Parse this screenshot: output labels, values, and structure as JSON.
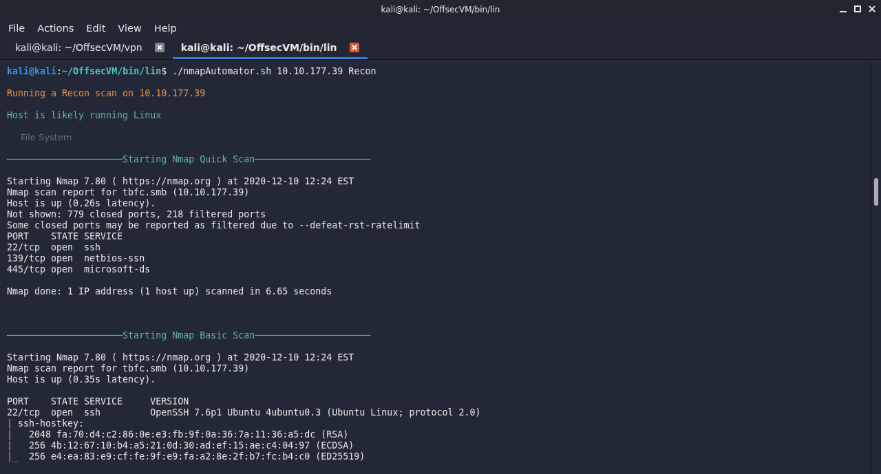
{
  "window": {
    "title": "kali@kali: ~/OffsecVM/bin/lin"
  },
  "menu": [
    "File",
    "Actions",
    "Edit",
    "View",
    "Help"
  ],
  "tabs": [
    {
      "label": "kali@kali: ~/OffsecVM/vpn",
      "selected": false
    },
    {
      "label": "kali@kali: ~/OffsecVM/bin/lin",
      "selected": true
    }
  ],
  "desktop": {
    "icon_label": "File System"
  },
  "terminal": {
    "lines": [
      {
        "kind": "text",
        "segments": [
          {
            "kind": "user",
            "text": "kali@kali"
          },
          {
            "kind": "plain",
            "text": ":"
          },
          {
            "kind": "path",
            "text": "~/OffsecVM/bin/lin"
          },
          {
            "kind": "plain",
            "text": "$ ./nmapAutomator.sh 10.10.177.39 Recon"
          }
        ]
      },
      {
        "kind": "blank"
      },
      {
        "kind": "text",
        "segments": [
          {
            "kind": "warn",
            "text": "Running a Recon scan on 10.10.177.39"
          }
        ]
      },
      {
        "kind": "blank"
      },
      {
        "kind": "text",
        "segments": [
          {
            "kind": "info",
            "text": "Host is likely running Linux"
          }
        ]
      },
      {
        "kind": "blank"
      },
      {
        "kind": "blank"
      },
      {
        "kind": "blank"
      },
      {
        "kind": "text",
        "segments": [
          {
            "kind": "info",
            "text": "─────────────────────Starting Nmap Quick Scan─────────────────────"
          }
        ]
      },
      {
        "kind": "blank"
      },
      {
        "kind": "text",
        "segments": [
          {
            "kind": "plain",
            "text": "Starting Nmap 7.80 ( https://nmap.org ) at 2020-12-10 12:24 EST"
          }
        ]
      },
      {
        "kind": "text",
        "segments": [
          {
            "kind": "plain",
            "text": "Nmap scan report for tbfc.smb (10.10.177.39)"
          }
        ]
      },
      {
        "kind": "text",
        "segments": [
          {
            "kind": "plain",
            "text": "Host is up (0.26s latency)."
          }
        ]
      },
      {
        "kind": "text",
        "segments": [
          {
            "kind": "plain",
            "text": "Not shown: 779 closed ports, 218 filtered ports"
          }
        ]
      },
      {
        "kind": "text",
        "segments": [
          {
            "kind": "plain",
            "text": "Some closed ports may be reported as filtered due to --defeat-rst-ratelimit"
          }
        ]
      },
      {
        "kind": "text",
        "segments": [
          {
            "kind": "plain",
            "text": "PORT    STATE SERVICE"
          }
        ]
      },
      {
        "kind": "text",
        "segments": [
          {
            "kind": "plain",
            "text": "22/tcp  open  ssh"
          }
        ]
      },
      {
        "kind": "text",
        "segments": [
          {
            "kind": "plain",
            "text": "139/tcp open  netbios-ssn"
          }
        ]
      },
      {
        "kind": "text",
        "segments": [
          {
            "kind": "plain",
            "text": "445/tcp open  microsoft-ds"
          }
        ]
      },
      {
        "kind": "blank"
      },
      {
        "kind": "text",
        "segments": [
          {
            "kind": "plain",
            "text": "Nmap done: 1 IP address (1 host up) scanned in 6.65 seconds"
          }
        ]
      },
      {
        "kind": "blank"
      },
      {
        "kind": "blank"
      },
      {
        "kind": "blank"
      },
      {
        "kind": "text",
        "segments": [
          {
            "kind": "info",
            "text": "─────────────────────Starting Nmap Basic Scan─────────────────────"
          }
        ]
      },
      {
        "kind": "blank"
      },
      {
        "kind": "text",
        "segments": [
          {
            "kind": "plain",
            "text": "Starting Nmap 7.80 ( https://nmap.org ) at 2020-12-10 12:24 EST"
          }
        ]
      },
      {
        "kind": "text",
        "segments": [
          {
            "kind": "plain",
            "text": "Nmap scan report for tbfc.smb (10.10.177.39)"
          }
        ]
      },
      {
        "kind": "text",
        "segments": [
          {
            "kind": "plain",
            "text": "Host is up (0.35s latency)."
          }
        ]
      },
      {
        "kind": "blank"
      },
      {
        "kind": "text",
        "segments": [
          {
            "kind": "plain",
            "text": "PORT    STATE SERVICE     VERSION"
          }
        ]
      },
      {
        "kind": "text",
        "segments": [
          {
            "kind": "plain",
            "text": "22/tcp  open  ssh         OpenSSH 7.6p1 Ubuntu 4ubuntu0.3 (Ubuntu Linux; protocol 2.0)"
          }
        ]
      },
      {
        "kind": "text",
        "segments": [
          {
            "kind": "bar",
            "text": "|"
          },
          {
            "kind": "plain",
            "text": " ssh-hostkey:"
          }
        ]
      },
      {
        "kind": "text",
        "segments": [
          {
            "kind": "bar",
            "text": "|"
          },
          {
            "kind": "plain",
            "text": "   2048 fa:70:d4:c2:86:0e:e3:fb:9f:0a:36:7a:11:36:a5:dc (RSA)"
          }
        ]
      },
      {
        "kind": "text",
        "segments": [
          {
            "kind": "bar",
            "text": "|"
          },
          {
            "kind": "plain",
            "text": "   256 4b:12:67:10:b4:a5:21:0d:30:ad:ef:15:ae:c4:04:97 (ECDSA)"
          }
        ]
      },
      {
        "kind": "text",
        "segments": [
          {
            "kind": "bar",
            "text": "|_"
          },
          {
            "kind": "plain",
            "text": "  256 e4:ea:83:e9:cf:fe:9f:e9:fa:a2:8e:2f:b7:fc:b4:c0 (ED25519)"
          }
        ]
      }
    ]
  }
}
